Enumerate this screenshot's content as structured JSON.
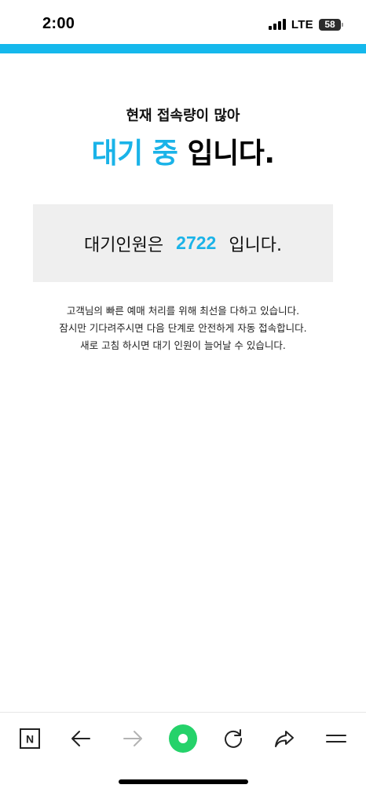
{
  "status_bar": {
    "time": "2:00",
    "network": "LTE",
    "battery": "58",
    "icons": [
      "signal-icon",
      "battery-icon"
    ]
  },
  "colors": {
    "accent": "#1ab3e8",
    "accent_bar": "#15b8ec",
    "go_button": "#25d26a",
    "box_bg": "#efefef"
  },
  "main": {
    "subtitle": "현재 접속량이 많아",
    "headline_accent": "대기 중",
    "headline_rest": "입니다.",
    "queue_prefix": "대기인원은",
    "queue_count": "2722",
    "queue_suffix": "입니다.",
    "notice_lines": [
      "고객님의 빠른 예매 처리를 위해 최선을 다하고 있습니다.",
      "잠시만 기다려주시면 다음 단계로 안전하게 자동 접속합니다.",
      "새로 고침 하시면 대기 인원이 늘어날 수 있습니다."
    ]
  },
  "toolbar": {
    "icons": [
      "naver-home-icon",
      "back-arrow-icon",
      "forward-arrow-icon",
      "green-dot-icon",
      "refresh-icon",
      "share-icon",
      "menu-icon"
    ],
    "home_glyph": "N"
  }
}
